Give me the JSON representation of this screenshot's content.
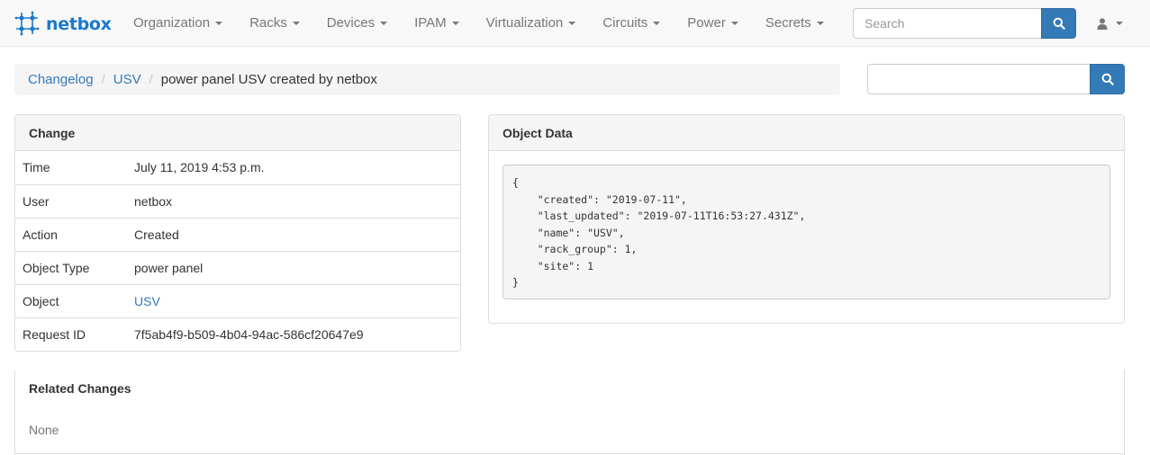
{
  "navbar": {
    "brand": "netbox",
    "brand_icon": "netbox-logo-icon",
    "menu": [
      {
        "label": "Organization"
      },
      {
        "label": "Racks"
      },
      {
        "label": "Devices"
      },
      {
        "label": "IPAM"
      },
      {
        "label": "Virtualization"
      },
      {
        "label": "Circuits"
      },
      {
        "label": "Power"
      },
      {
        "label": "Secrets"
      }
    ],
    "search_placeholder": "Search",
    "user_icon": "user-icon"
  },
  "breadcrumb": {
    "items": [
      "Changelog",
      "USV"
    ],
    "current": "power panel USV created by netbox"
  },
  "side_search": {
    "placeholder": ""
  },
  "change": {
    "heading": "Change",
    "rows": [
      {
        "key": "Time",
        "value": "July 11, 2019 4:53 p.m."
      },
      {
        "key": "User",
        "value": "netbox"
      },
      {
        "key": "Action",
        "value": "Created"
      },
      {
        "key": "Object Type",
        "value": "power panel"
      },
      {
        "key": "Object",
        "value": "USV"
      },
      {
        "key": "Request ID",
        "value": "7f5ab4f9-b509-4b04-94ac-586cf20647e9"
      }
    ]
  },
  "object_data": {
    "heading": "Object Data",
    "json": "{\n    \"created\": \"2019-07-11\",\n    \"last_updated\": \"2019-07-11T16:53:27.431Z\",\n    \"name\": \"USV\",\n    \"rack_group\": 1,\n    \"site\": 1\n}"
  },
  "related": {
    "heading": "Related Changes",
    "empty_text": "None"
  },
  "colors": {
    "brand": "#1a7acb",
    "link": "#337ab7",
    "primary_button": "#337ab7"
  }
}
